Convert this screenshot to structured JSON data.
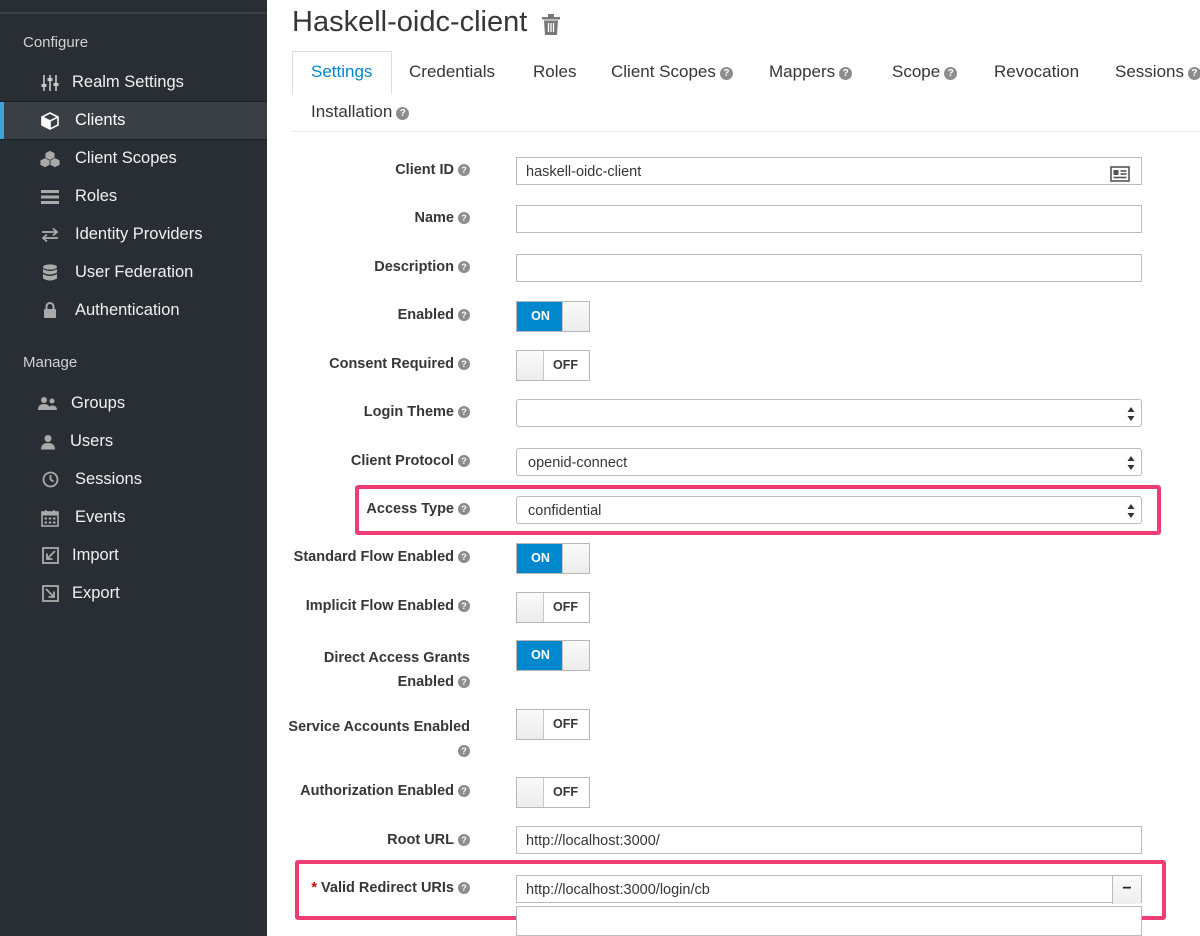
{
  "sidebar": {
    "configure_title": "Configure",
    "manage_title": "Manage",
    "configure_items": [
      {
        "label": "Realm Settings",
        "icon": "sliders-icon"
      },
      {
        "label": "Clients",
        "icon": "cube-icon",
        "active": true
      },
      {
        "label": "Client Scopes",
        "icon": "cubes-icon"
      },
      {
        "label": "Roles",
        "icon": "list-icon"
      },
      {
        "label": "Identity Providers",
        "icon": "exchange-icon"
      },
      {
        "label": "User Federation",
        "icon": "database-icon"
      },
      {
        "label": "Authentication",
        "icon": "lock-icon"
      }
    ],
    "manage_items": [
      {
        "label": "Groups",
        "icon": "users-icon"
      },
      {
        "label": "Users",
        "icon": "user-icon"
      },
      {
        "label": "Sessions",
        "icon": "clock-icon"
      },
      {
        "label": "Events",
        "icon": "calendar-icon"
      },
      {
        "label": "Import",
        "icon": "import-icon"
      },
      {
        "label": "Export",
        "icon": "export-icon"
      }
    ]
  },
  "header": {
    "title": "Haskell-oidc-client"
  },
  "tabs": [
    {
      "label": "Settings",
      "help": false,
      "active": true
    },
    {
      "label": "Credentials",
      "help": false
    },
    {
      "label": "Roles",
      "help": false
    },
    {
      "label": "Client Scopes",
      "help": true
    },
    {
      "label": "Mappers",
      "help": true
    },
    {
      "label": "Scope",
      "help": true
    },
    {
      "label": "Revocation",
      "help": false
    },
    {
      "label": "Sessions",
      "help": true
    },
    {
      "label": "Installation",
      "help": true
    }
  ],
  "form": {
    "client_id": {
      "label": "Client ID",
      "value": "haskell-oidc-client"
    },
    "name": {
      "label": "Name",
      "value": ""
    },
    "description": {
      "label": "Description",
      "value": ""
    },
    "enabled": {
      "label": "Enabled",
      "state": "ON"
    },
    "consent_required": {
      "label": "Consent Required",
      "state": "OFF"
    },
    "login_theme": {
      "label": "Login Theme",
      "value": ""
    },
    "client_protocol": {
      "label": "Client Protocol",
      "value": "openid-connect"
    },
    "access_type": {
      "label": "Access Type",
      "value": "confidential"
    },
    "standard_flow": {
      "label": "Standard Flow Enabled",
      "state": "ON"
    },
    "implicit_flow": {
      "label": "Implicit Flow Enabled",
      "state": "OFF"
    },
    "direct_access": {
      "label_line1": "Direct Access Grants",
      "label_line2": "Enabled",
      "state": "ON"
    },
    "service_accounts": {
      "label": "Service Accounts Enabled",
      "state": "OFF"
    },
    "authorization": {
      "label": "Authorization Enabled",
      "state": "OFF"
    },
    "root_url": {
      "label": "Root URL",
      "value": "http://localhost:3000/"
    },
    "redirect_uris": {
      "required_mark": "*",
      "label": "Valid Redirect URIs",
      "value": "http://localhost:3000/login/cb",
      "remove_label": "−"
    }
  },
  "colors": {
    "accent": "#0088ce",
    "highlight": "#ef3c73",
    "sidebar_bg": "#292e34"
  }
}
